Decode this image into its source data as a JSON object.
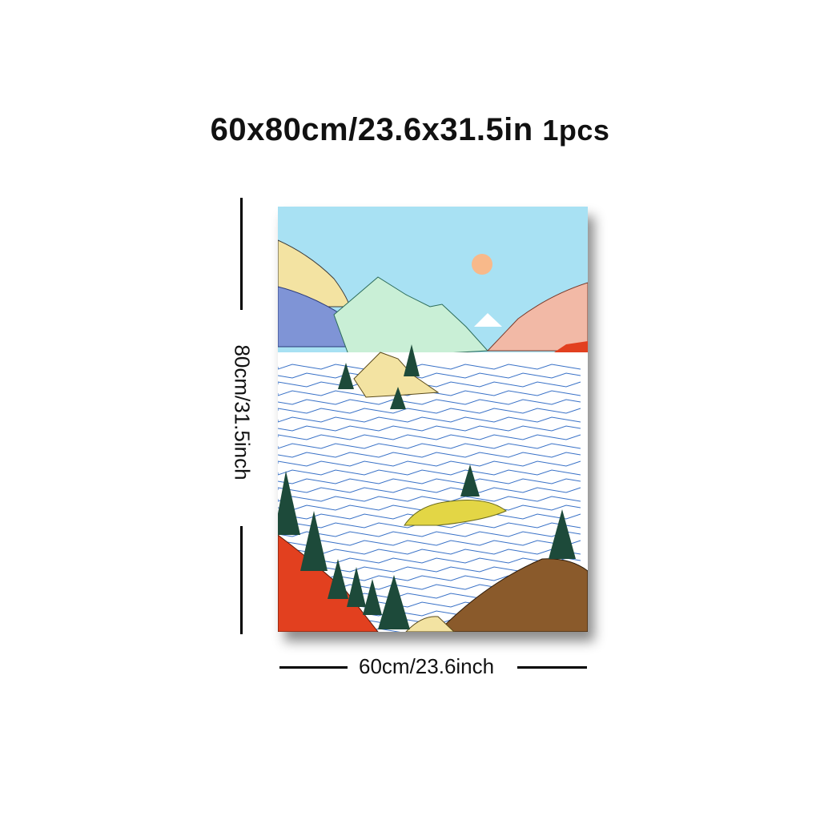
{
  "header": {
    "size_text": "60x80cm/23.6x31.5in",
    "quantity_text": "1pcs"
  },
  "dimensions": {
    "height_label": "80cm/31.5inch",
    "width_label": "60cm/23.6inch"
  },
  "artwork": {
    "subject": "mountain-lake-landscape",
    "colors": {
      "sky": "#a8e1f3",
      "sun": "#f8b98a",
      "water": "#ffffff",
      "wave_lines": "#3a72c7",
      "mint_mountain": "#c9efd6",
      "yellow_mountain": "#f3e3a2",
      "blue_hill": "#7f94d6",
      "pink_mountain": "#f2b9a6",
      "red_hill": "#e2401f",
      "brown_hill": "#8a5a2b",
      "tree": "#1d4a3a",
      "island_yellow": "#e3d645"
    }
  }
}
